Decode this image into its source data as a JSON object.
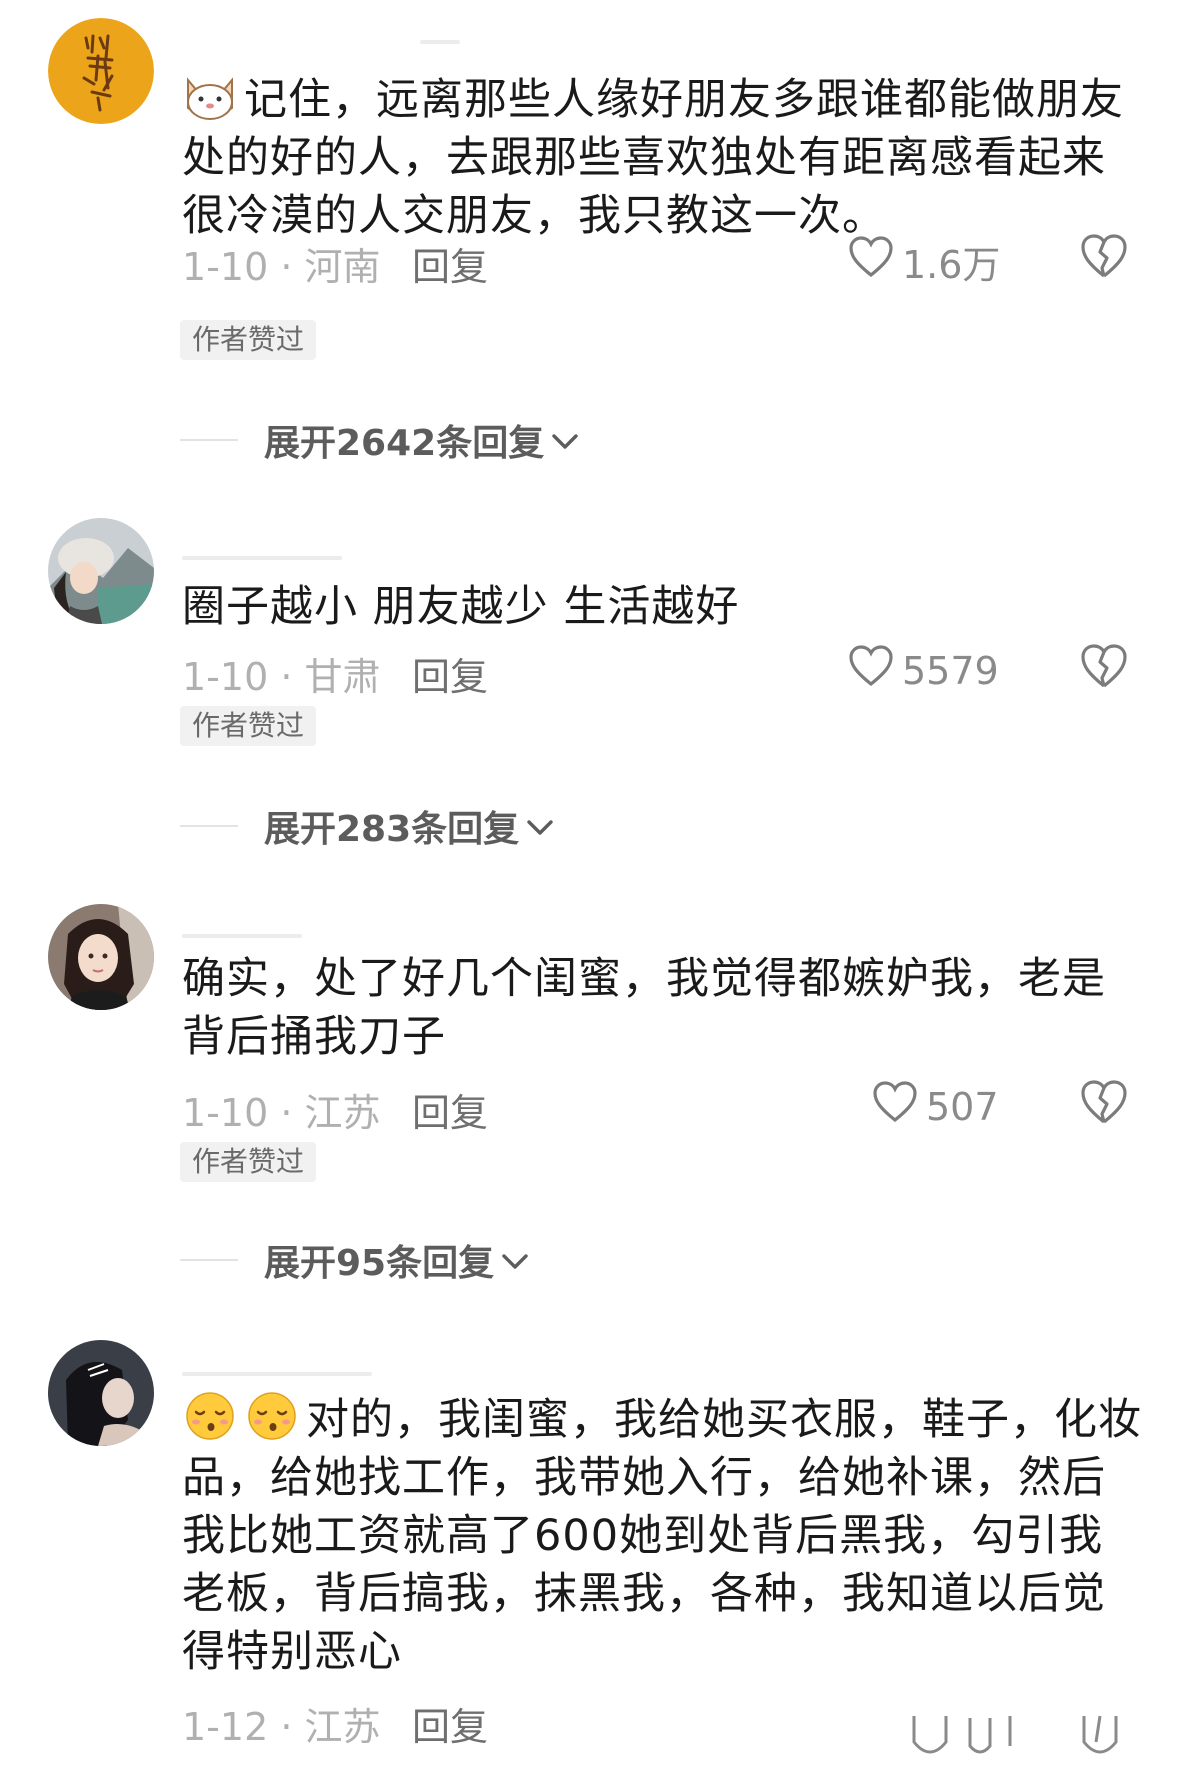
{
  "comments": [
    {
      "avatar": "calligraphy-avatar",
      "leading_emoji": [
        "cat-face-emoji"
      ],
      "text": "记住，远离那些人缘好朋友多跟谁都能做朋友处的好的人，去跟那些喜欢独处有距离感看起来很冷漠的人交朋友，我只教这一次。",
      "date_location": "1-10 · 河南",
      "reply_label": "回复",
      "likes": "1.6万",
      "badge": "作者赞过",
      "expand_label": "展开2642条回复"
    },
    {
      "avatar": "girl-mountain-avatar",
      "leading_emoji": [],
      "text": "圈子越小 朋友越少 生活越好",
      "date_location": "1-10 · 甘肃",
      "reply_label": "回复",
      "likes": "5579",
      "badge": "作者赞过",
      "expand_label": "展开283条回复"
    },
    {
      "avatar": "girl-portrait-avatar",
      "leading_emoji": [],
      "text": "确实，处了好几个闺蜜，我觉得都嫉妒我，老是背后捅我刀子",
      "date_location": "1-10 · 江苏",
      "reply_label": "回复",
      "likes": "507",
      "badge": "作者赞过",
      "expand_label": "展开95条回复"
    },
    {
      "avatar": "dark-hair-girl-avatar",
      "leading_emoji": [
        "sighing-face-emoji",
        "sighing-face-emoji"
      ],
      "text": "对的，我闺蜜，我给她买衣服，鞋子，化妆品，给她找工作，我带她入行，给她补课，然后我比她工资就高了600她到处背后黑我，勾引我老板，背后搞我，抹黑我，各种，我知道以后觉得特别恶心",
      "date_location": "1-12 · 江苏",
      "reply_label": "回复"
    }
  ],
  "icons": {
    "like": "heart-outline-icon",
    "dislike": "broken-heart-icon",
    "expand": "chevron-down-icon"
  },
  "colors": {
    "text": "#1a1a1a",
    "meta": "#b0b0b0",
    "badge_bg": "#f1f1f1"
  }
}
